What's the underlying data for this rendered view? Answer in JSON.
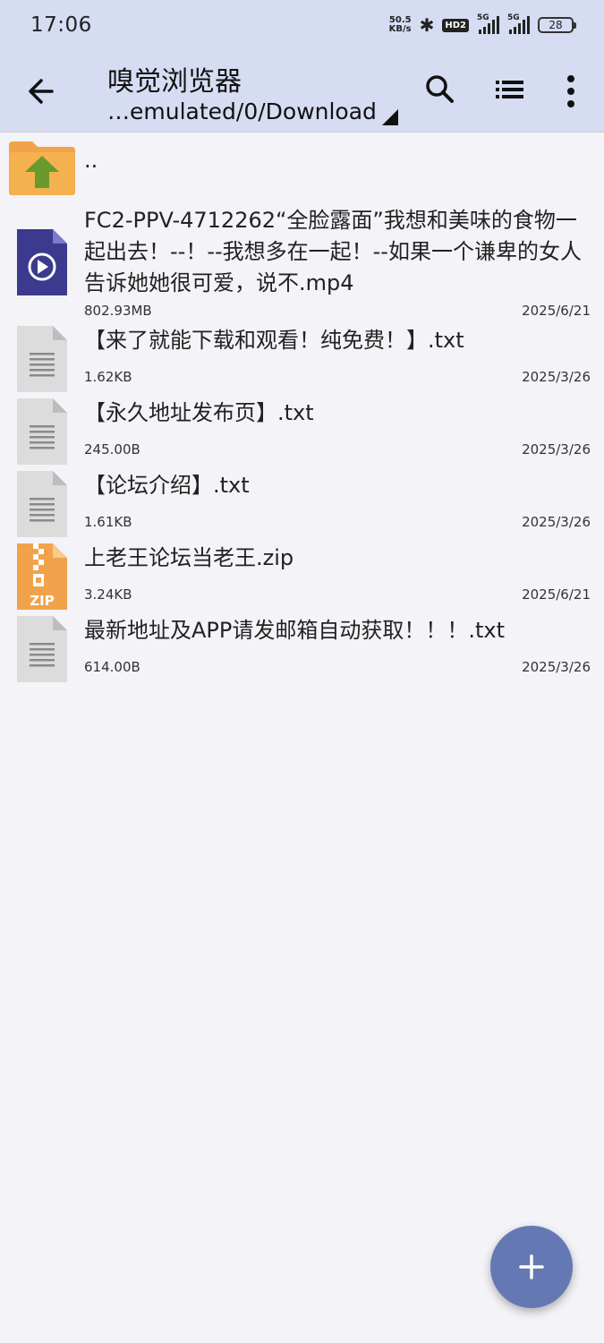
{
  "status": {
    "time": "17:06",
    "net_speed_value": "50.5",
    "net_speed_unit": "KB/s",
    "hd_badge": "HD2",
    "sim1": "5G",
    "sim2": "5G",
    "battery": "28"
  },
  "appbar": {
    "title": "嗅觉浏览器",
    "path": "…emulated/0/Download"
  },
  "parent_dir": "..",
  "files": [
    {
      "name": "FC2-PPV-4712262“全脸露面”我想和美味的食物一起出去！--！--我想多在一起！--如果一个谦卑的女人告诉她她很可爱，说不.mp4",
      "size": "802.93MB",
      "date": "2025/6/21",
      "icon": "video-file-icon"
    },
    {
      "name": "【来了就能下载和观看！纯免费！】.txt",
      "size": "1.62KB",
      "date": "2025/3/26",
      "icon": "text-file-icon"
    },
    {
      "name": "【永久地址发布页】.txt",
      "size": "245.00B",
      "date": "2025/3/26",
      "icon": "text-file-icon"
    },
    {
      "name": "【论坛介绍】.txt",
      "size": "1.61KB",
      "date": "2025/3/26",
      "icon": "text-file-icon"
    },
    {
      "name": "上老王论坛当老王.zip",
      "size": "3.24KB",
      "date": "2025/6/21",
      "icon": "zip-file-icon",
      "icon_label": "ZIP"
    },
    {
      "name": "最新地址及APP请发邮箱自动获取！！！.txt",
      "size": "614.00B",
      "date": "2025/3/26",
      "icon": "text-file-icon"
    }
  ],
  "colors": {
    "appbar": "#d6dcf2",
    "background": "#f4f3f7",
    "fab": "#6479b3",
    "folder": "#f0a34a",
    "video_icon": "#3b3a8f",
    "zip_icon": "#f0a34a"
  }
}
